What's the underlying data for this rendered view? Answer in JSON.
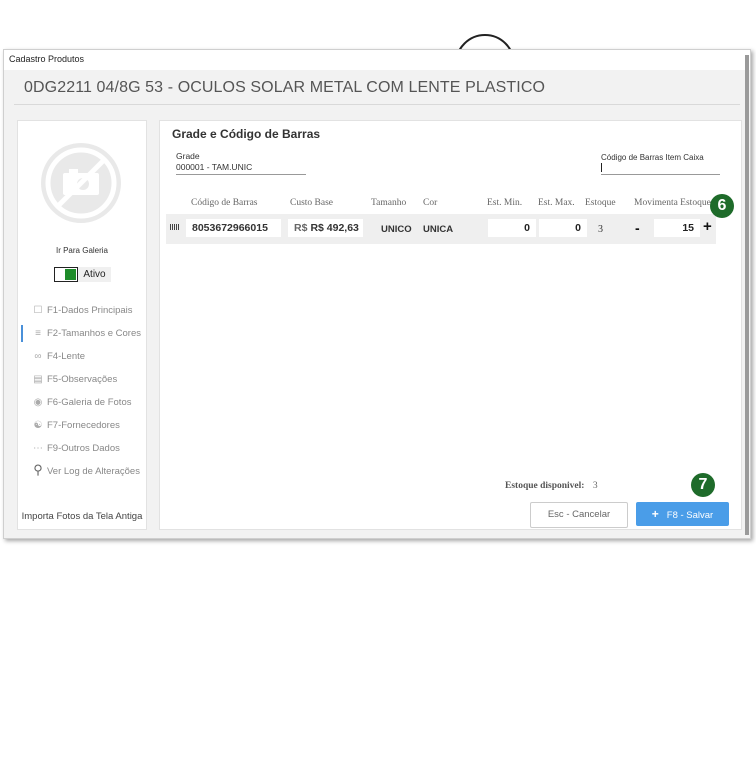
{
  "window": {
    "title": "Cadastro Produtos"
  },
  "product": {
    "title": "0DG2211 04/8G 53 - OCULOS SOLAR METAL COM LENTE PLASTICO"
  },
  "sidebar": {
    "gallery_link": "Ir Para Galeria",
    "toggle_label": "Ativo",
    "toggle_on": true,
    "items": [
      {
        "label": "F1-Dados Principais",
        "icon": "form-icon"
      },
      {
        "label": "F2-Tamanhos  e Cores",
        "icon": "list-icon"
      },
      {
        "label": "F4-Lente",
        "icon": "glasses-icon"
      },
      {
        "label": "F5-Observações",
        "icon": "notes-icon"
      },
      {
        "label": "F6-Galeria de Fotos",
        "icon": "camera-icon"
      },
      {
        "label": "F7-Fornecedores",
        "icon": "supplier-icon"
      },
      {
        "label": "F9-Outros Dados",
        "icon": "dots-icon"
      },
      {
        "label": "Ver Log de Alterações",
        "icon": "search-icon"
      }
    ],
    "import_link": "Importa Fotos da Tela Antiga"
  },
  "main": {
    "section_title": "Grade e Código de Barras",
    "grade_label": "Grade",
    "grade_value": "000001 - TAM.UNIC",
    "barcode_item_label": "Código de Barras Item Caixa",
    "barcode_item_value": "",
    "columns": [
      "Código de Barras",
      "Custo Base",
      "Tamanho",
      "Cor",
      "Est. Min.",
      "Est. Max.",
      "Estoque",
      "Movimenta Estoque"
    ],
    "row": {
      "barcode": "8053672966015",
      "currency": "R$",
      "cost": "R$ 492,63",
      "size": "UNICO",
      "color": "UNICA",
      "est_min": "0",
      "est_max": "0",
      "stock": "3",
      "minus": "-",
      "move_qty": "15",
      "plus": "+"
    },
    "stock_available_label": "Estoque disponivel:",
    "stock_available_value": "3",
    "cancel_button": "Esc - Cancelar",
    "save_button_icon": "+",
    "save_button": "F8 - Salvar"
  },
  "badges": {
    "badge_6": "6",
    "badge_7": "7"
  },
  "colors": {
    "accent": "#4a9de8",
    "badge": "#1e6b2a",
    "toggle": "#1e8c2a"
  }
}
